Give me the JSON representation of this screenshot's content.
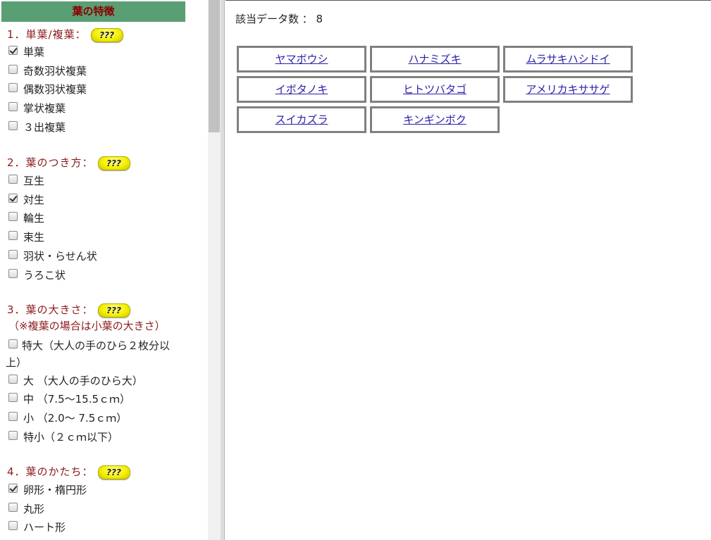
{
  "sidebar": {
    "header": "葉の特徴",
    "help_badge": "???",
    "sections": [
      {
        "heading": "1．単葉/複葉：",
        "options": [
          {
            "label": "単葉",
            "checked": true
          },
          {
            "label": "奇数羽状複葉",
            "checked": false
          },
          {
            "label": "偶数羽状複葉",
            "checked": false
          },
          {
            "label": "掌状複葉",
            "checked": false
          },
          {
            "label": "３出複葉",
            "checked": false
          }
        ]
      },
      {
        "heading": "2．葉のつき方：",
        "options": [
          {
            "label": "互生",
            "checked": false
          },
          {
            "label": "対生",
            "checked": true
          },
          {
            "label": "輪生",
            "checked": false
          },
          {
            "label": "束生",
            "checked": false
          },
          {
            "label": "羽状・らせん状",
            "checked": false
          },
          {
            "label": "うろこ状",
            "checked": false
          }
        ]
      },
      {
        "heading": "3．葉の大きさ：",
        "note": "（※複葉の場合は小葉の大きさ）",
        "options": [
          {
            "label": "特大（大人の手のひら２枚分以上）",
            "checked": false
          },
          {
            "label": "大 （大人の手のひら大）",
            "checked": false
          },
          {
            "label": "中 （7.5～15.5ｃｍ）",
            "checked": false
          },
          {
            "label": "小 （2.0～ 7.5ｃｍ）",
            "checked": false
          },
          {
            "label": "特小（２ｃｍ以下）",
            "checked": false
          }
        ]
      },
      {
        "heading": "4．葉のかたち：",
        "options": [
          {
            "label": "卵形・楕円形",
            "checked": true
          },
          {
            "label": "丸形",
            "checked": false
          },
          {
            "label": "ハート形",
            "checked": false
          }
        ]
      }
    ]
  },
  "results": {
    "count_label": "該当データ数 ： 8",
    "items": [
      "ヤマボウシ",
      "ハナミズキ",
      "ムラサキハシドイ",
      "イボタノキ",
      "ヒトツバタゴ",
      "アメリカキササゲ",
      "スイカズラ",
      "キンギンボク"
    ]
  },
  "colors": {
    "header_bg": "#5a9e74",
    "header_text": "#8b0000",
    "heading_text": "#8b1a1a",
    "link": "#2a1fa8",
    "cell_border": "#808080"
  }
}
